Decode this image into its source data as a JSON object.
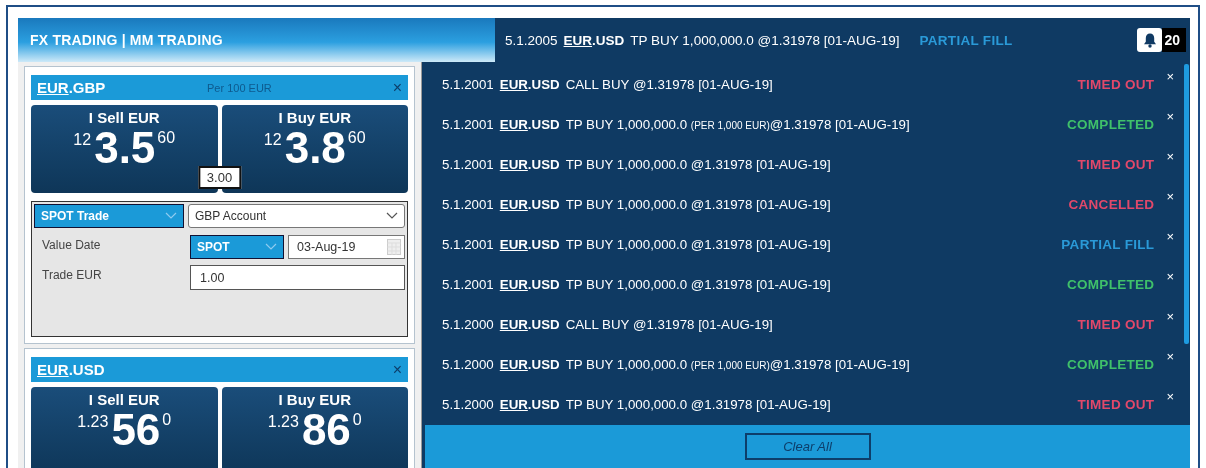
{
  "header": {
    "title": "FX TRADING | MM TRADING",
    "latest": {
      "id": "5.1.2005",
      "base": "EUR",
      "quote": ".USD",
      "order": "TP BUY 1,000,000.0 @1.31978 [01-AUG-19]",
      "status": "PARTIAL FILL",
      "kind": "partial_fill"
    },
    "count": "20"
  },
  "tiles": [
    {
      "base": "EUR",
      "quote": ".GBP",
      "unit": "Per 100 EUR",
      "close": "×",
      "prices": [
        {
          "label": "I Sell EUR",
          "prefix": "12",
          "big": "3.5",
          "pips": "60"
        },
        {
          "label": "I Buy EUR",
          "prefix": "12",
          "big": "3.8",
          "pips": "60"
        }
      ],
      "spread": "3.00",
      "form": {
        "trade_type": "SPOT Trade",
        "account": "GBP Account",
        "value_date_label": "Value Date",
        "tenor": "SPOT",
        "date": "03-Aug-19",
        "amount_label": "Trade EUR",
        "amount": "1.00"
      }
    },
    {
      "base": "EUR",
      "quote": ".USD",
      "close": "×",
      "prices": [
        {
          "label": "I Sell EUR",
          "prefix": "1.23",
          "big": "56",
          "pips": "0"
        },
        {
          "label": "I Buy EUR",
          "prefix": "1.23",
          "big": "86",
          "pips": "0"
        }
      ]
    }
  ],
  "notifications": {
    "items": [
      {
        "id": "5.1.2001",
        "base": "EUR",
        "quote": ".USD",
        "order": "CALL BUY @1.31978 [01-AUG-19]",
        "status": "TIMED OUT",
        "kind": "timed_out"
      },
      {
        "id": "5.1.2001",
        "base": "EUR",
        "quote": ".USD",
        "order": "TP BUY 1,000,000.0",
        "note": "(PER 1,000 EUR)",
        "price": "@1.31978 [01-AUG-19]",
        "status": "COMPLETED",
        "kind": "completed"
      },
      {
        "id": "5.1.2001",
        "base": "EUR",
        "quote": ".USD",
        "order": "TP BUY 1,000,000.0 @1.31978 [01-AUG-19]",
        "status": "TIMED OUT",
        "kind": "timed_out"
      },
      {
        "id": "5.1.2001",
        "base": "EUR",
        "quote": ".USD",
        "order": "TP BUY 1,000,000.0 @1.31978 [01-AUG-19]",
        "status": "CANCELLED",
        "kind": "cancelled"
      },
      {
        "id": "5.1.2001",
        "base": "EUR",
        "quote": ".USD",
        "order": "TP BUY 1,000,000.0 @1.31978 [01-AUG-19]",
        "status": "PARTIAL FILL",
        "kind": "partial_fill"
      },
      {
        "id": "5.1.2001",
        "base": "EUR",
        "quote": ".USD",
        "order": "TP BUY 1,000,000.0 @1.31978 [01-AUG-19]",
        "status": "COMPLETED",
        "kind": "completed"
      },
      {
        "id": "5.1.2000",
        "base": "EUR",
        "quote": ".USD",
        "order": "CALL BUY @1.31978 [01-AUG-19]",
        "status": "TIMED OUT",
        "kind": "timed_out"
      },
      {
        "id": "5.1.2000",
        "base": "EUR",
        "quote": ".USD",
        "order": "TP BUY 1,000,000.0",
        "note": "(PER 1,000 EUR)",
        "price": "@1.31978 [01-AUG-19]",
        "status": "COMPLETED",
        "kind": "completed"
      },
      {
        "id": "5.1.2000",
        "base": "EUR",
        "quote": ".USD",
        "order": "TP BUY 1,000,000.0 @1.31978 [01-AUG-19]",
        "status": "TIMED OUT",
        "kind": "timed_out"
      }
    ],
    "dismiss": "×",
    "clear_all": "Clear All"
  }
}
